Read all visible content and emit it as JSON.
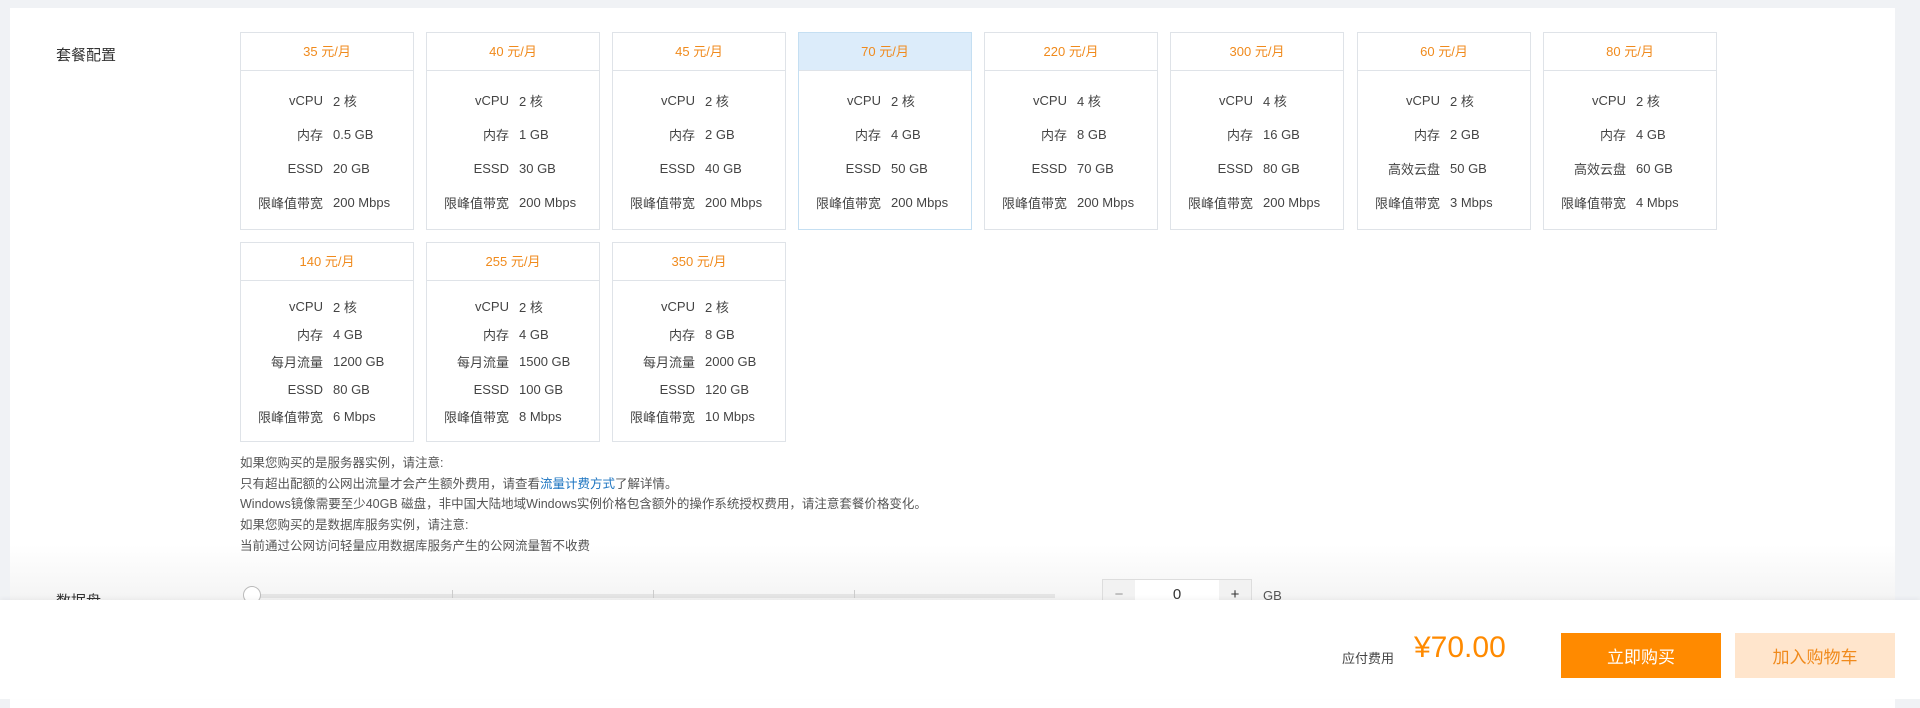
{
  "section_label": "套餐配置",
  "data_disk_label": "数据盘",
  "row1": [
    {
      "price": "35 元/月",
      "specs": [
        [
          "vCPU",
          "2 核"
        ],
        [
          "内存",
          "0.5 GB"
        ],
        [
          "ESSD",
          "20 GB"
        ],
        [
          "限峰值带宽",
          "200 Mbps"
        ]
      ]
    },
    {
      "price": "40 元/月",
      "specs": [
        [
          "vCPU",
          "2 核"
        ],
        [
          "内存",
          "1 GB"
        ],
        [
          "ESSD",
          "30 GB"
        ],
        [
          "限峰值带宽",
          "200 Mbps"
        ]
      ]
    },
    {
      "price": "45 元/月",
      "specs": [
        [
          "vCPU",
          "2 核"
        ],
        [
          "内存",
          "2 GB"
        ],
        [
          "ESSD",
          "40 GB"
        ],
        [
          "限峰值带宽",
          "200 Mbps"
        ]
      ]
    },
    {
      "price": "70 元/月",
      "specs": [
        [
          "vCPU",
          "2 核"
        ],
        [
          "内存",
          "4 GB"
        ],
        [
          "ESSD",
          "50 GB"
        ],
        [
          "限峰值带宽",
          "200 Mbps"
        ]
      ],
      "selected": true
    },
    {
      "price": "220 元/月",
      "specs": [
        [
          "vCPU",
          "4 核"
        ],
        [
          "内存",
          "8 GB"
        ],
        [
          "ESSD",
          "70 GB"
        ],
        [
          "限峰值带宽",
          "200 Mbps"
        ]
      ]
    },
    {
      "price": "300 元/月",
      "specs": [
        [
          "vCPU",
          "4 核"
        ],
        [
          "内存",
          "16 GB"
        ],
        [
          "ESSD",
          "80 GB"
        ],
        [
          "限峰值带宽",
          "200 Mbps"
        ]
      ]
    },
    {
      "price": "60 元/月",
      "specs": [
        [
          "vCPU",
          "2 核"
        ],
        [
          "内存",
          "2 GB"
        ],
        [
          "高效云盘",
          "50 GB"
        ],
        [
          "限峰值带宽",
          "3 Mbps"
        ]
      ]
    },
    {
      "price": "80 元/月",
      "specs": [
        [
          "vCPU",
          "2 核"
        ],
        [
          "内存",
          "4 GB"
        ],
        [
          "高效云盘",
          "60 GB"
        ],
        [
          "限峰值带宽",
          "4 Mbps"
        ]
      ]
    }
  ],
  "row2": [
    {
      "price": "140 元/月",
      "specs": [
        [
          "vCPU",
          "2 核"
        ],
        [
          "内存",
          "4 GB"
        ],
        [
          "每月流量",
          "1200 GB"
        ],
        [
          "ESSD",
          "80 GB"
        ],
        [
          "限峰值带宽",
          "6 Mbps"
        ]
      ]
    },
    {
      "price": "255 元/月",
      "specs": [
        [
          "vCPU",
          "2 核"
        ],
        [
          "内存",
          "4 GB"
        ],
        [
          "每月流量",
          "1500 GB"
        ],
        [
          "ESSD",
          "100 GB"
        ],
        [
          "限峰值带宽",
          "8 Mbps"
        ]
      ]
    },
    {
      "price": "350 元/月",
      "specs": [
        [
          "vCPU",
          "2 核"
        ],
        [
          "内存",
          "8 GB"
        ],
        [
          "每月流量",
          "2000 GB"
        ],
        [
          "ESSD",
          "120 GB"
        ],
        [
          "限峰值带宽",
          "10 Mbps"
        ]
      ]
    }
  ],
  "notes": {
    "l1": "如果您购买的是服务器实例，请注意:",
    "l2a": "只有超出配额的公网出流量才会产生额外费用，请查看",
    "l2link": "流量计费方式",
    "l2b": "了解详情。",
    "l3": "Windows镜像需要至少40GB 磁盘，非中国大陆地域Windows实例价格包含额外的操作系统授权费用，请注意套餐价格变化。",
    "l4": "如果您购买的是数据库服务实例，请注意:",
    "l5": "当前通过公网访问轻量应用数据库服务产生的公网流量暂不收费"
  },
  "stepper": {
    "minus": "−",
    "value": "0",
    "plus": "+",
    "unit": "GB"
  },
  "footer": {
    "pay_label": "应付费用",
    "price": "¥70.00",
    "buy": "立即购买",
    "cart": "加入购物车"
  }
}
